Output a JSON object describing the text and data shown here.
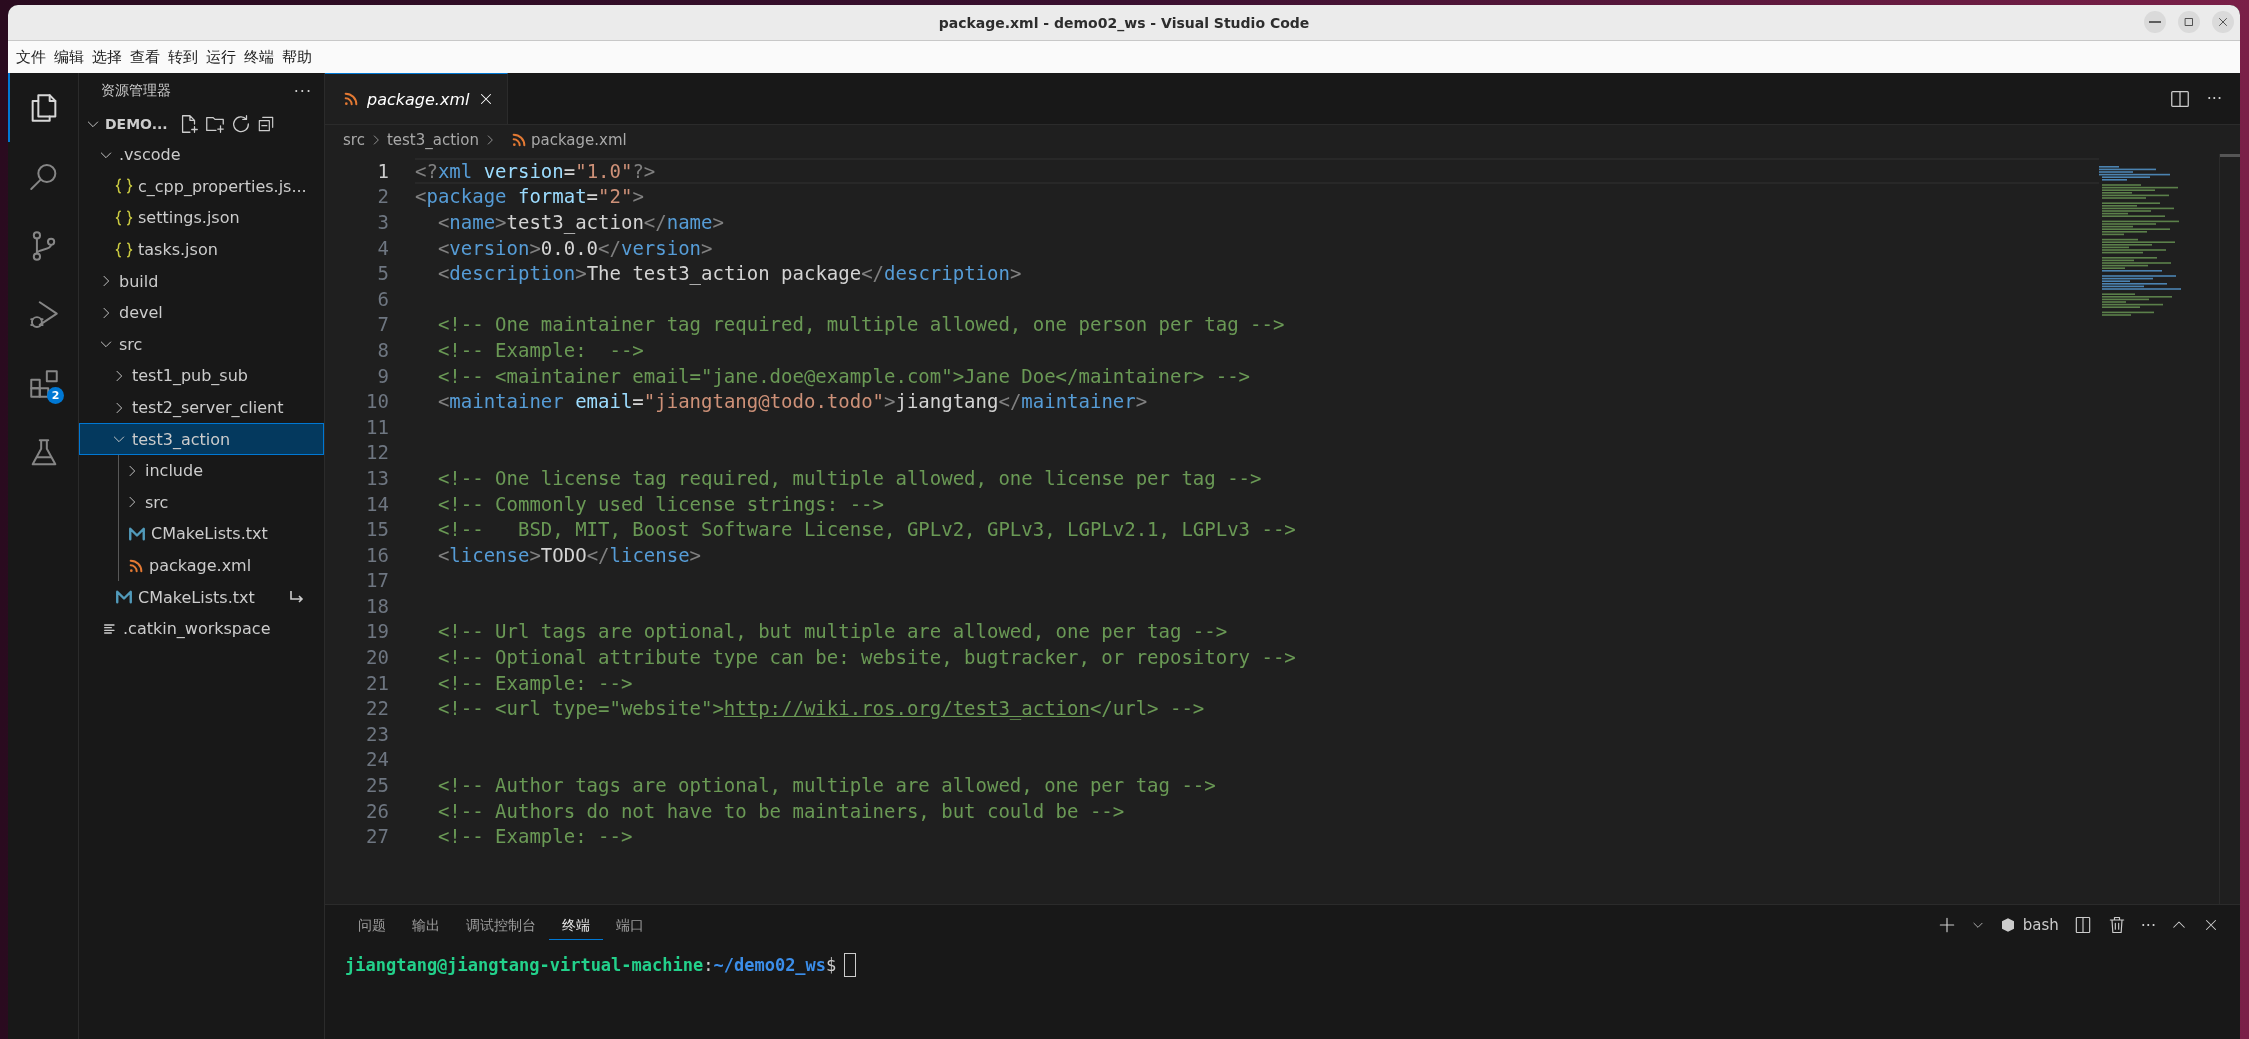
{
  "window": {
    "title": "package.xml - demo02_ws - Visual Studio Code"
  },
  "menu": [
    "文件",
    "编辑",
    "选择",
    "查看",
    "转到",
    "运行",
    "终端",
    "帮助"
  ],
  "activity_bar": [
    {
      "kind": "explorer",
      "selected": true
    },
    {
      "kind": "search",
      "selected": false
    },
    {
      "kind": "source-control",
      "selected": false
    },
    {
      "kind": "run-debug",
      "selected": false
    },
    {
      "kind": "extensions",
      "selected": false,
      "badge": "2"
    },
    {
      "kind": "testing",
      "selected": false
    }
  ],
  "sidebar": {
    "title": "资源管理器",
    "more": "···",
    "root": "DEMO...",
    "tree": [
      {
        "label": ".vscode",
        "kind": "folder",
        "expanded": true,
        "selected": false,
        "children": [
          {
            "label": "c_cpp_properties.js...",
            "kind": "json",
            "selected": false
          },
          {
            "label": "settings.json",
            "kind": "json",
            "selected": false
          },
          {
            "label": "tasks.json",
            "kind": "json",
            "selected": false
          }
        ]
      },
      {
        "label": "build",
        "kind": "folder",
        "expanded": false,
        "selected": false
      },
      {
        "label": "devel",
        "kind": "folder",
        "expanded": false,
        "selected": false
      },
      {
        "label": "src",
        "kind": "folder",
        "expanded": true,
        "selected": false,
        "children": [
          {
            "label": "test1_pub_sub",
            "kind": "folder",
            "expanded": false,
            "selected": false
          },
          {
            "label": "test2_server_client",
            "kind": "folder",
            "expanded": false,
            "selected": false
          },
          {
            "label": "test3_action",
            "kind": "folder",
            "expanded": true,
            "selected": true,
            "children": [
              {
                "label": "include",
                "kind": "folder",
                "expanded": false,
                "selected": false
              },
              {
                "label": "src",
                "kind": "folder",
                "expanded": false,
                "selected": false
              },
              {
                "label": "CMakeLists.txt",
                "kind": "cmake",
                "selected": false
              },
              {
                "label": "package.xml",
                "kind": "xml",
                "selected": false
              }
            ]
          },
          {
            "label": "CMakeLists.txt",
            "kind": "cmake",
            "selected": false,
            "symlink": true
          }
        ]
      },
      {
        "label": ".catkin_workspace",
        "kind": "lines",
        "selected": false
      }
    ]
  },
  "editor": {
    "tabs": [
      {
        "label": "package.xml",
        "selected": true,
        "preview": true
      }
    ],
    "more": "···",
    "breadcrumbs": [
      "src",
      "test3_action",
      "package.xml"
    ],
    "lines": [
      {
        "number": "1",
        "current": true,
        "tokens": [
          {
            "kind": "punct",
            "text": "<?"
          },
          {
            "kind": "tag",
            "text": "xml"
          },
          {
            "kind": "attr",
            "text": " version"
          },
          {
            "kind": "text",
            "text": "="
          },
          {
            "kind": "str",
            "text": "\"1.0\""
          },
          {
            "kind": "punct",
            "text": "?>"
          }
        ]
      },
      {
        "number": "2",
        "current": false,
        "tokens": [
          {
            "kind": "punct",
            "text": "<"
          },
          {
            "kind": "tag",
            "text": "package"
          },
          {
            "kind": "attr",
            "text": " format"
          },
          {
            "kind": "text",
            "text": "="
          },
          {
            "kind": "str",
            "text": "\"2\""
          },
          {
            "kind": "punct",
            "text": ">"
          }
        ]
      },
      {
        "number": "3",
        "current": false,
        "tokens": [
          {
            "kind": "punct",
            "text": "  <"
          },
          {
            "kind": "tag",
            "text": "name"
          },
          {
            "kind": "punct",
            "text": ">"
          },
          {
            "kind": "text",
            "text": "test3_action"
          },
          {
            "kind": "punct",
            "text": "</"
          },
          {
            "kind": "tag",
            "text": "name"
          },
          {
            "kind": "punct",
            "text": ">"
          }
        ]
      },
      {
        "number": "4",
        "current": false,
        "tokens": [
          {
            "kind": "punct",
            "text": "  <"
          },
          {
            "kind": "tag",
            "text": "version"
          },
          {
            "kind": "punct",
            "text": ">"
          },
          {
            "kind": "text",
            "text": "0.0.0"
          },
          {
            "kind": "punct",
            "text": "</"
          },
          {
            "kind": "tag",
            "text": "version"
          },
          {
            "kind": "punct",
            "text": ">"
          }
        ]
      },
      {
        "number": "5",
        "current": false,
        "tokens": [
          {
            "kind": "punct",
            "text": "  <"
          },
          {
            "kind": "tag",
            "text": "description"
          },
          {
            "kind": "punct",
            "text": ">"
          },
          {
            "kind": "text",
            "text": "The test3_action package"
          },
          {
            "kind": "punct",
            "text": "</"
          },
          {
            "kind": "tag",
            "text": "description"
          },
          {
            "kind": "punct",
            "text": ">"
          }
        ]
      },
      {
        "number": "6",
        "current": false
      },
      {
        "number": "7",
        "current": false,
        "tokens": [
          {
            "kind": "comment",
            "text": "  <!-- One maintainer tag required, multiple allowed, one person per tag -->"
          }
        ]
      },
      {
        "number": "8",
        "current": false,
        "tokens": [
          {
            "kind": "comment",
            "text": "  <!-- Example:  -->"
          }
        ]
      },
      {
        "number": "9",
        "current": false,
        "tokens": [
          {
            "kind": "comment",
            "text": "  <!-- <maintainer email=\"jane.doe@example.com\">Jane Doe</maintainer> -->"
          }
        ]
      },
      {
        "number": "10",
        "current": false,
        "tokens": [
          {
            "kind": "punct",
            "text": "  <"
          },
          {
            "kind": "tag",
            "text": "maintainer"
          },
          {
            "kind": "attr",
            "text": " email"
          },
          {
            "kind": "text",
            "text": "="
          },
          {
            "kind": "str",
            "text": "\"jiangtang@todo.todo\""
          },
          {
            "kind": "punct",
            "text": ">"
          },
          {
            "kind": "text",
            "text": "jiangtang"
          },
          {
            "kind": "punct",
            "text": "</"
          },
          {
            "kind": "tag",
            "text": "maintainer"
          },
          {
            "kind": "punct",
            "text": ">"
          }
        ]
      },
      {
        "number": "11",
        "current": false
      },
      {
        "number": "12",
        "current": false
      },
      {
        "number": "13",
        "current": false,
        "tokens": [
          {
            "kind": "comment",
            "text": "  <!-- One license tag required, multiple allowed, one license per tag -->"
          }
        ]
      },
      {
        "number": "14",
        "current": false,
        "tokens": [
          {
            "kind": "comment",
            "text": "  <!-- Commonly used license strings: -->"
          }
        ]
      },
      {
        "number": "15",
        "current": false,
        "tokens": [
          {
            "kind": "comment",
            "text": "  <!--   BSD, MIT, Boost Software License, GPLv2, GPLv3, LGPLv2.1, LGPLv3 -->"
          }
        ]
      },
      {
        "number": "16",
        "current": false,
        "tokens": [
          {
            "kind": "punct",
            "text": "  <"
          },
          {
            "kind": "tag",
            "text": "license"
          },
          {
            "kind": "punct",
            "text": ">"
          },
          {
            "kind": "text",
            "text": "TODO"
          },
          {
            "kind": "punct",
            "text": "</"
          },
          {
            "kind": "tag",
            "text": "license"
          },
          {
            "kind": "punct",
            "text": ">"
          }
        ]
      },
      {
        "number": "17",
        "current": false
      },
      {
        "number": "18",
        "current": false
      },
      {
        "number": "19",
        "current": false,
        "tokens": [
          {
            "kind": "comment",
            "text": "  <!-- Url tags are optional, but multiple are allowed, one per tag -->"
          }
        ]
      },
      {
        "number": "20",
        "current": false,
        "tokens": [
          {
            "kind": "comment",
            "text": "  <!-- Optional attribute type can be: website, bugtracker, or repository -->"
          }
        ]
      },
      {
        "number": "21",
        "current": false,
        "tokens": [
          {
            "kind": "comment",
            "text": "  <!-- Example: -->"
          }
        ]
      },
      {
        "number": "22",
        "current": false,
        "tokens": [
          {
            "kind": "comment",
            "text": "  <!-- <url type=\"website\">"
          },
          {
            "kind": "link",
            "text": "http://wiki.ros.org/test3_action"
          },
          {
            "kind": "comment",
            "text": "</url> -->"
          }
        ]
      },
      {
        "number": "23",
        "current": false
      },
      {
        "number": "24",
        "current": false
      },
      {
        "number": "25",
        "current": false,
        "tokens": [
          {
            "kind": "comment",
            "text": "  <!-- Author tags are optional, multiple are allowed, one per tag -->"
          }
        ]
      },
      {
        "number": "26",
        "current": false,
        "tokens": [
          {
            "kind": "comment",
            "text": "  <!-- Authors do not have to be maintainers, but could be -->"
          }
        ]
      },
      {
        "number": "27",
        "current": false,
        "tokens": [
          {
            "kind": "comment",
            "text": "  <!-- Example: -->"
          }
        ]
      }
    ]
  },
  "panel": {
    "tabs": [
      {
        "label": "问题",
        "selected": false
      },
      {
        "label": "输出",
        "selected": false
      },
      {
        "label": "调试控制台",
        "selected": false
      },
      {
        "label": "终端",
        "selected": true
      },
      {
        "label": "端口",
        "selected": false
      }
    ],
    "shell": "bash",
    "more": "···",
    "prompt": {
      "user": "jiangtang@jiangtang-virtual-machine",
      "sep": ":",
      "path": "~/demo02_ws",
      "symbol": "$"
    }
  }
}
